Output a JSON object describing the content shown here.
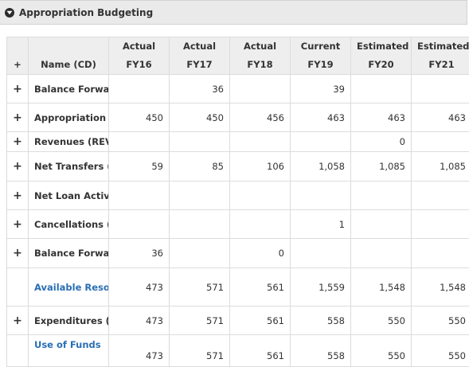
{
  "section": {
    "title": "Appropriation Budgeting"
  },
  "table": {
    "plus_header": "+",
    "name_header": "Name (CD)",
    "columns": [
      {
        "type": "Actual",
        "year": "FY16"
      },
      {
        "type": "Actual",
        "year": "FY17"
      },
      {
        "type": "Actual",
        "year": "FY18"
      },
      {
        "type": "Current",
        "year": "FY19"
      },
      {
        "type": "Estimated",
        "year": "FY20"
      },
      {
        "type": "Estimated",
        "year": "FY21"
      }
    ],
    "rows": [
      {
        "expand": "+",
        "name": "Balance Forward In (BFIN)",
        "values": [
          "",
          "36",
          "",
          "39",
          "",
          ""
        ]
      },
      {
        "expand": "+",
        "name": "Appropriation (APPTOT)",
        "values": [
          "450",
          "450",
          "456",
          "463",
          "463",
          "463"
        ]
      },
      {
        "expand": "+",
        "name": "Revenues (REV)",
        "values": [
          "",
          "",
          "",
          "",
          "0",
          ""
        ]
      },
      {
        "expand": "+",
        "name": "Net Transfers (NETTRAN)",
        "values": [
          "59",
          "85",
          "106",
          "1,058",
          "1,085",
          "1,085"
        ]
      },
      {
        "expand": "+",
        "name": "Net Loan Activity (NETLOAN)",
        "values": [
          "",
          "",
          "",
          "",
          "",
          ""
        ]
      },
      {
        "expand": "+",
        "name": "Cancellations (CANCEL)",
        "values": [
          "",
          "",
          "",
          "1",
          "",
          ""
        ]
      },
      {
        "expand": "+",
        "name": "Balance Forward Out (BFOUT)",
        "values": [
          "36",
          "",
          "0",
          "",
          "",
          ""
        ]
      },
      {
        "expand": "",
        "name": "Available Resources (SOURCES)",
        "values": [
          "473",
          "571",
          "561",
          "1,559",
          "1,548",
          "1,548"
        ]
      },
      {
        "expand": "+",
        "name": "Expenditures (EXP)",
        "values": [
          "473",
          "571",
          "561",
          "558",
          "550",
          "550"
        ]
      },
      {
        "expand": "",
        "name": "Use of Funds",
        "values": [
          "473",
          "571",
          "561",
          "558",
          "550",
          "550"
        ]
      }
    ]
  }
}
